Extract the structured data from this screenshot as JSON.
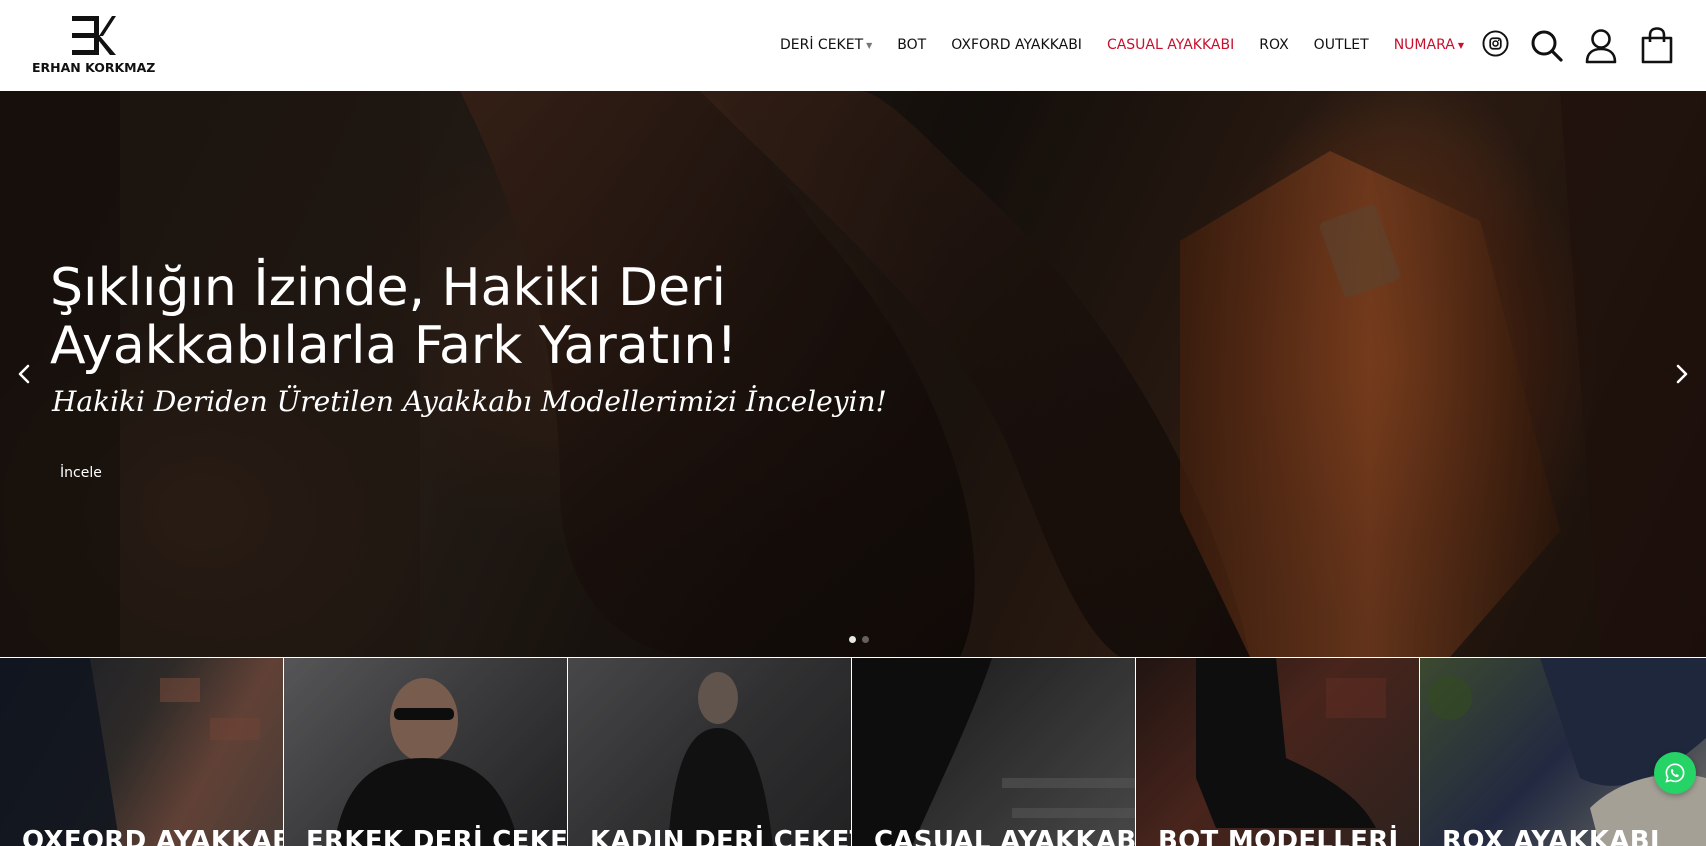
{
  "brand": {
    "name": "ERHAN KORKMAZ",
    "logo_mark": "EK"
  },
  "nav": {
    "items": [
      {
        "label": "DERİ CEKET",
        "has_dropdown": true,
        "highlight": false
      },
      {
        "label": "BOT",
        "has_dropdown": false,
        "highlight": false
      },
      {
        "label": "OXFORD AYAKKABI",
        "has_dropdown": false,
        "highlight": false
      },
      {
        "label": "CASUAL AYAKKABI",
        "has_dropdown": false,
        "highlight": true
      },
      {
        "label": "ROX",
        "has_dropdown": false,
        "highlight": false
      },
      {
        "label": "OUTLET",
        "has_dropdown": false,
        "highlight": false
      },
      {
        "label": "NUMARA",
        "has_dropdown": true,
        "highlight": true
      }
    ],
    "icons": [
      "instagram-icon",
      "search-icon",
      "user-icon",
      "shopping-bag-icon"
    ]
  },
  "hero": {
    "title": "Şıklığın İzinde, Hakiki Deri Ayakkabılarla Fark Yaratın!",
    "subtitle": "Hakiki Deriden Üretilen Ayakkabı Modellerimizi İnceleyin!",
    "button_label": "İncele",
    "slide_count": 2,
    "active_slide": 0
  },
  "categories": [
    {
      "label": "OXFORD AYAKKABI"
    },
    {
      "label": "ERKEK DERİ CEKET"
    },
    {
      "label": "KADIN DERİ CEKET"
    },
    {
      "label": "CASUAL AYAKKABI"
    },
    {
      "label": "BOT MODELLERİ"
    },
    {
      "label": "ROX AYAKKABI"
    }
  ],
  "colors": {
    "accent_red": "#c8102e",
    "whatsapp_green": "#25d366",
    "text_dark": "#111111"
  }
}
